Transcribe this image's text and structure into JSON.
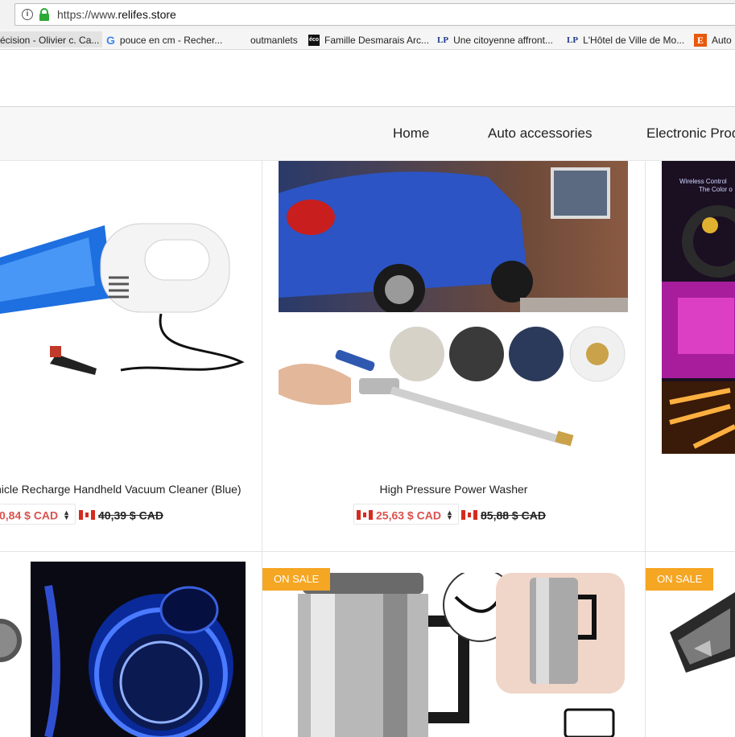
{
  "browser": {
    "url_scheme": "https://www.",
    "url_host": "relifes.store",
    "bookmarks": [
      {
        "label": "écision - Olivier c. Ca...",
        "icon": "page-icon"
      },
      {
        "label": "pouce en cm - Recher...",
        "icon": "google-icon"
      },
      {
        "label": "outmanlets",
        "icon": "blank-icon"
      },
      {
        "label": "Famille Desmarais Arc...",
        "icon": "eco-icon",
        "icon_text": "éco"
      },
      {
        "label": "Une citoyenne affront...",
        "icon": "la-presse-icon",
        "icon_text": "LP"
      },
      {
        "label": "L'Hôtel de Ville de Mo...",
        "icon": "la-presse-icon",
        "icon_text": "LP"
      },
      {
        "label": "Auto",
        "icon": "e-icon",
        "icon_text": "E"
      }
    ]
  },
  "nav": {
    "items": [
      "Home",
      "Auto accessories",
      "Electronic Prod"
    ]
  },
  "products": [
    {
      "name": "hicle Recharge Handheld Vacuum Cleaner (Blue)",
      "price": "0,84 $ CAD",
      "old_price": "40,39 $ CAD"
    },
    {
      "name": "High Pressure Power Washer",
      "price": "25,63 $ CAD",
      "old_price": "85,88 $ CAD"
    }
  ],
  "badges": {
    "on_sale": "ON SALE"
  },
  "colors": {
    "sale_price": "#d9534f",
    "badge": "#f5a623",
    "secure_lock": "#2ea836"
  }
}
